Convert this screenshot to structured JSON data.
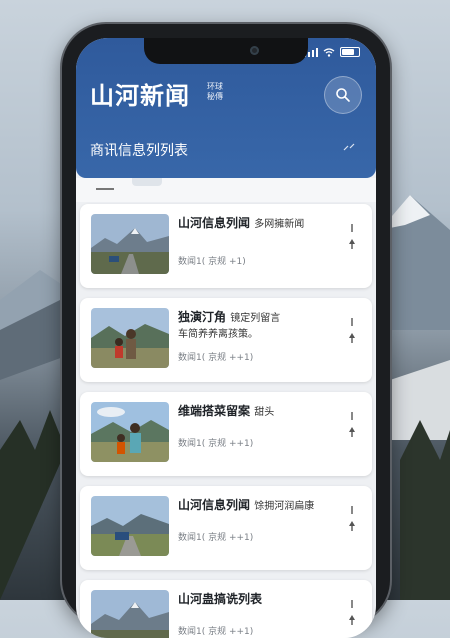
{
  "header": {
    "logo": "山河新闻",
    "logo_sub": "环球 秘傳",
    "section_title": "商讯信息列列表"
  },
  "colors": {
    "header": "#3867a9",
    "card": "#ffffff",
    "meta": "#7a7f86"
  },
  "icons": {
    "search": "search-icon",
    "sort": "sort-icon",
    "more": "more-vertical-icon"
  },
  "news": [
    {
      "title": "山河信息列闻",
      "title_tail": "多网擁新闻",
      "title2": "",
      "meta": "数闻1( 京规 +1)"
    },
    {
      "title": "独演汀角",
      "title_tail": "镜定列留言",
      "title2": "车简养养离孩策。",
      "meta": "数闻1( 京规 ++1)"
    },
    {
      "title": "维端搭菜留案",
      "title_tail": "甜头",
      "title2": "",
      "meta": "数闻1( 京规 ++1)"
    },
    {
      "title": "山河信息列闻",
      "title_tail": "馀拥河润扁康",
      "title2": "",
      "meta": "数闻1( 京规 ++1)"
    },
    {
      "title": "山河蛊搞诜列表",
      "title_tail": "",
      "title2": "",
      "meta": "数闻1( 京规 ++1)"
    }
  ]
}
